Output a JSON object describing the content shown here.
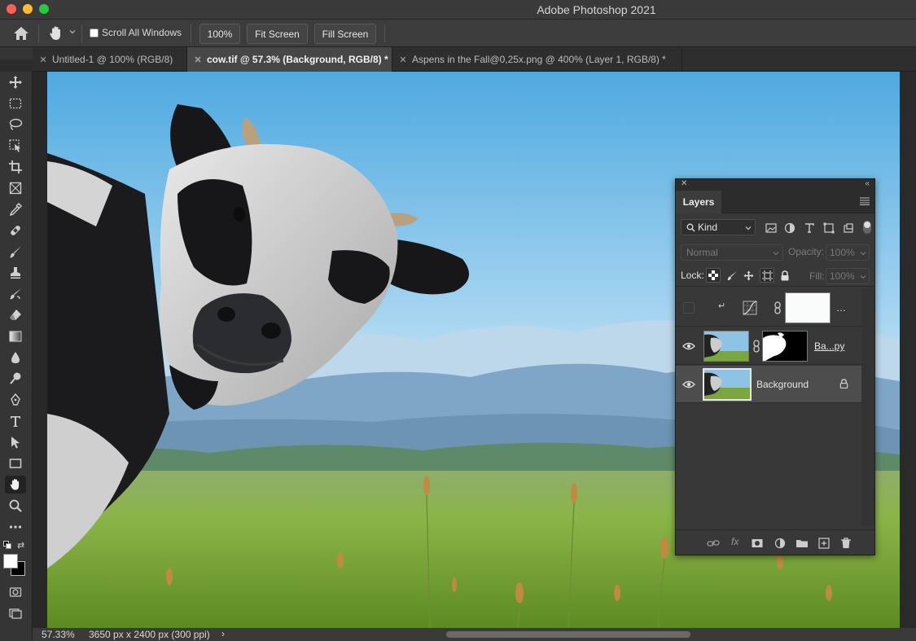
{
  "app": {
    "title": "Adobe Photoshop 2021"
  },
  "options": {
    "scroll_all_label": "Scroll All Windows",
    "zoom_btn": "100%",
    "fit_screen": "Fit Screen",
    "fill_screen": "Fill Screen",
    "scroll_all_checked": false
  },
  "tabs": [
    {
      "label": "Untitled-1 @ 100% (RGB/8)",
      "active": false
    },
    {
      "label": "cow.tif @ 57.3% (Background, RGB/8) *",
      "active": true
    },
    {
      "label": "Aspens in the Fall@0,25x.png @ 400% (Layer 1, RGB/8) *",
      "active": false
    }
  ],
  "tools": [
    "move-tool-icon",
    "marquee-tool-icon",
    "lasso-tool-icon",
    "object-select-tool-icon",
    "crop-tool-icon",
    "frame-tool-icon",
    "eyedropper-tool-icon",
    "healing-brush-tool-icon",
    "brush-tool-icon",
    "clone-stamp-tool-icon",
    "history-brush-tool-icon",
    "eraser-tool-icon",
    "gradient-tool-icon",
    "blur-tool-icon",
    "dodge-tool-icon",
    "pen-tool-icon",
    "type-tool-icon",
    "path-select-tool-icon",
    "rectangle-tool-icon",
    "hand-tool-icon",
    "zoom-tool-icon",
    "more-tools-icon"
  ],
  "active_tool": "hand-tool-icon",
  "colors": {
    "foreground": "#ffffff",
    "background": "#000000",
    "accent": "#1473e6"
  },
  "status": {
    "zoom": "57.33%",
    "doc_size": "3650 px x 2400 px (300 ppi)",
    "chevron": "›"
  },
  "layers_panel": {
    "tab": "Layers",
    "kind": "Kind",
    "blend_mode": "Normal",
    "opacity_label": "Opacity:",
    "opacity_value": "100%",
    "lock_label": "Lock:",
    "fill_label": "Fill:",
    "fill_value": "100%",
    "layers": [
      {
        "name": "…",
        "visible": false,
        "type": "adjustment"
      },
      {
        "name": "Ba...py",
        "visible": true,
        "type": "masked"
      },
      {
        "name": "Background",
        "visible": true,
        "type": "background",
        "locked": true,
        "selected": true
      }
    ]
  }
}
